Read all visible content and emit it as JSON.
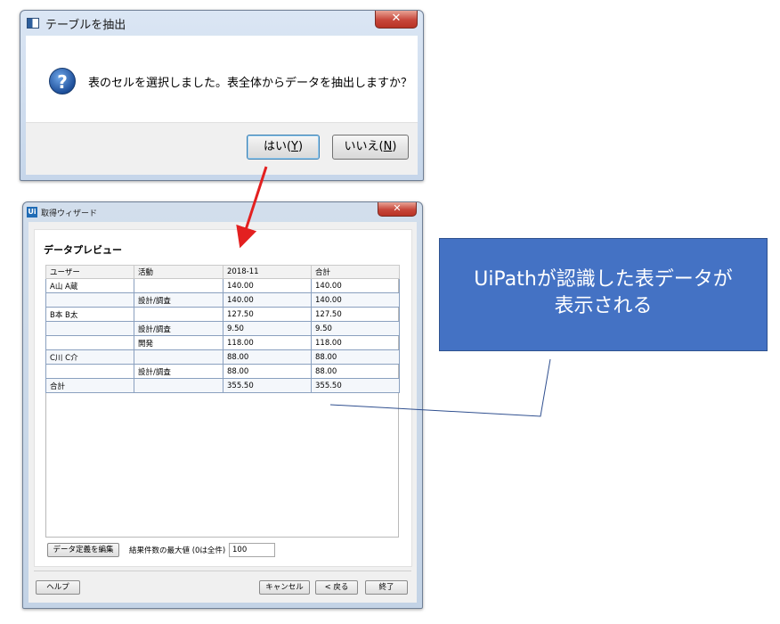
{
  "dialog": {
    "title": "テーブルを抽出",
    "message": "表のセルを選択しました。表全体からデータを抽出しますか？",
    "close_label": "✕",
    "yes_text": "はい(",
    "yes_key": "Y",
    "no_text": "いいえ(",
    "no_key": "N",
    "paren_close": ")"
  },
  "wizard": {
    "title": "取得ウィザード",
    "close_label": "✕",
    "section_title": "データプレビュー",
    "table": {
      "columns": [
        "ユーザー",
        "活動",
        "2018-11",
        "合計"
      ],
      "rows": [
        [
          "A山 A蔵",
          "",
          "140.00",
          "140.00"
        ],
        [
          "",
          "設計/調査",
          "140.00",
          "140.00"
        ],
        [
          "B本 B太",
          "",
          "127.50",
          "127.50"
        ],
        [
          "",
          "設計/調査",
          "9.50",
          "9.50"
        ],
        [
          "",
          "開発",
          "118.00",
          "118.00"
        ],
        [
          "C川 C介",
          "",
          "88.00",
          "88.00"
        ],
        [
          "",
          "設計/調査",
          "88.00",
          "88.00"
        ],
        [
          "合計",
          "",
          "355.50",
          "355.50"
        ]
      ]
    },
    "edit_data_button": "データ定義を編集",
    "max_results_label": "結果件数の最大値 (0は全件)",
    "max_results_value": "100",
    "help_button": "ヘルプ",
    "cancel_button": "キャンセル",
    "back_button": "< 戻る",
    "finish_button": "終了"
  },
  "callout": {
    "line1": "UiPathが認識した表データが",
    "line2": "表示される"
  },
  "colors": {
    "callout_fill": "#4472c4",
    "arrow": "#e32020",
    "leader_line": "#2f4f8f"
  }
}
